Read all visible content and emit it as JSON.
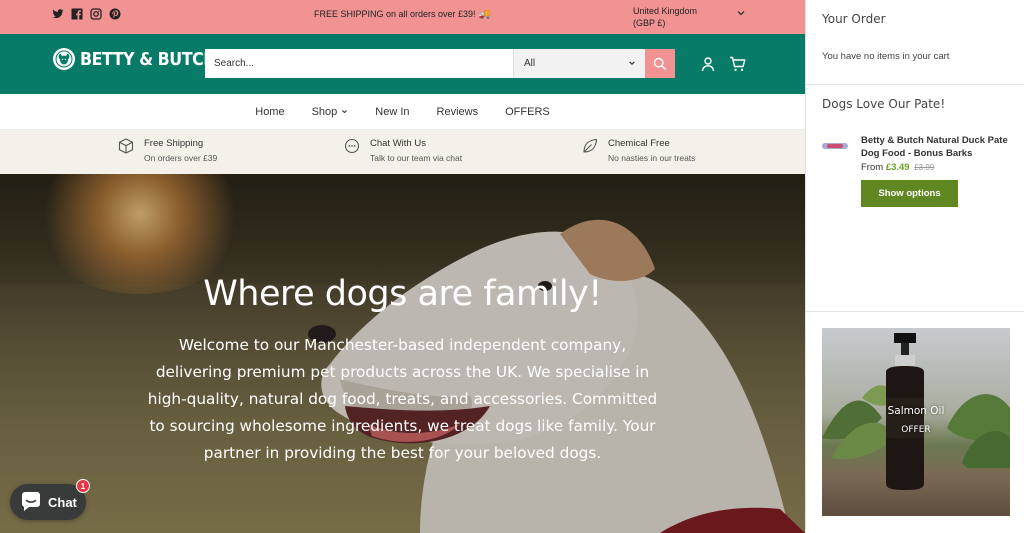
{
  "topbar": {
    "social_icons": [
      "twitter-icon",
      "facebook-icon",
      "instagram-icon",
      "pinterest-icon"
    ],
    "shipping_message": "FREE SHIPPING on all orders over £39!",
    "shipping_emoji": "🚚",
    "region_country": "United Kingdom",
    "region_currency": "(GBP £)"
  },
  "header": {
    "logo_text": "BETTY & BUTCH",
    "logo_mark": "®",
    "search_placeholder": "Search...",
    "search_category": "All"
  },
  "nav": {
    "items": [
      {
        "label": "Home"
      },
      {
        "label": "Shop"
      },
      {
        "label": "New In"
      },
      {
        "label": "Reviews"
      },
      {
        "label": "OFFERS"
      }
    ]
  },
  "features": [
    {
      "title": "Free Shipping",
      "subtitle": "On orders over £39",
      "icon": "box-icon"
    },
    {
      "title": "Chat With Us",
      "subtitle": "Talk to our team via chat",
      "icon": "chat-bubble-icon"
    },
    {
      "title": "Chemical Free",
      "subtitle": "No nasties in our treats",
      "icon": "leaf-icon"
    }
  ],
  "hero": {
    "title": "Where dogs are family!",
    "text": "Welcome to our Manchester-based independent company, delivering premium pet products across the UK. We specialise in high-quality, natural dog food, treats, and accessories. Committed to sourcing wholesome ingredients, we treat dogs like family. Your partner in providing the best for your beloved dogs."
  },
  "chat": {
    "label": "Chat",
    "badge_count": "1"
  },
  "drawer": {
    "title": "Your Order",
    "empty_message": "You have no items in your cart",
    "upsell_title": "Dogs Love Our Pate!",
    "product": {
      "name": "Betty & Butch Natural Duck Pate Dog Food - Bonus Barks",
      "price_prefix": "From",
      "price": "£3.49",
      "compare_price": "£3.99",
      "button_label": "Show options"
    },
    "promo": {
      "title": "Salmon Oil",
      "subtitle": "OFFER"
    }
  },
  "colors": {
    "topbar": "#f19393",
    "header": "#087a68",
    "features_bg": "#f4f1ea",
    "price_green": "#6fa128",
    "button_green": "#5f8822",
    "chat_bg": "#393a3a",
    "badge_red": "#e23745"
  }
}
